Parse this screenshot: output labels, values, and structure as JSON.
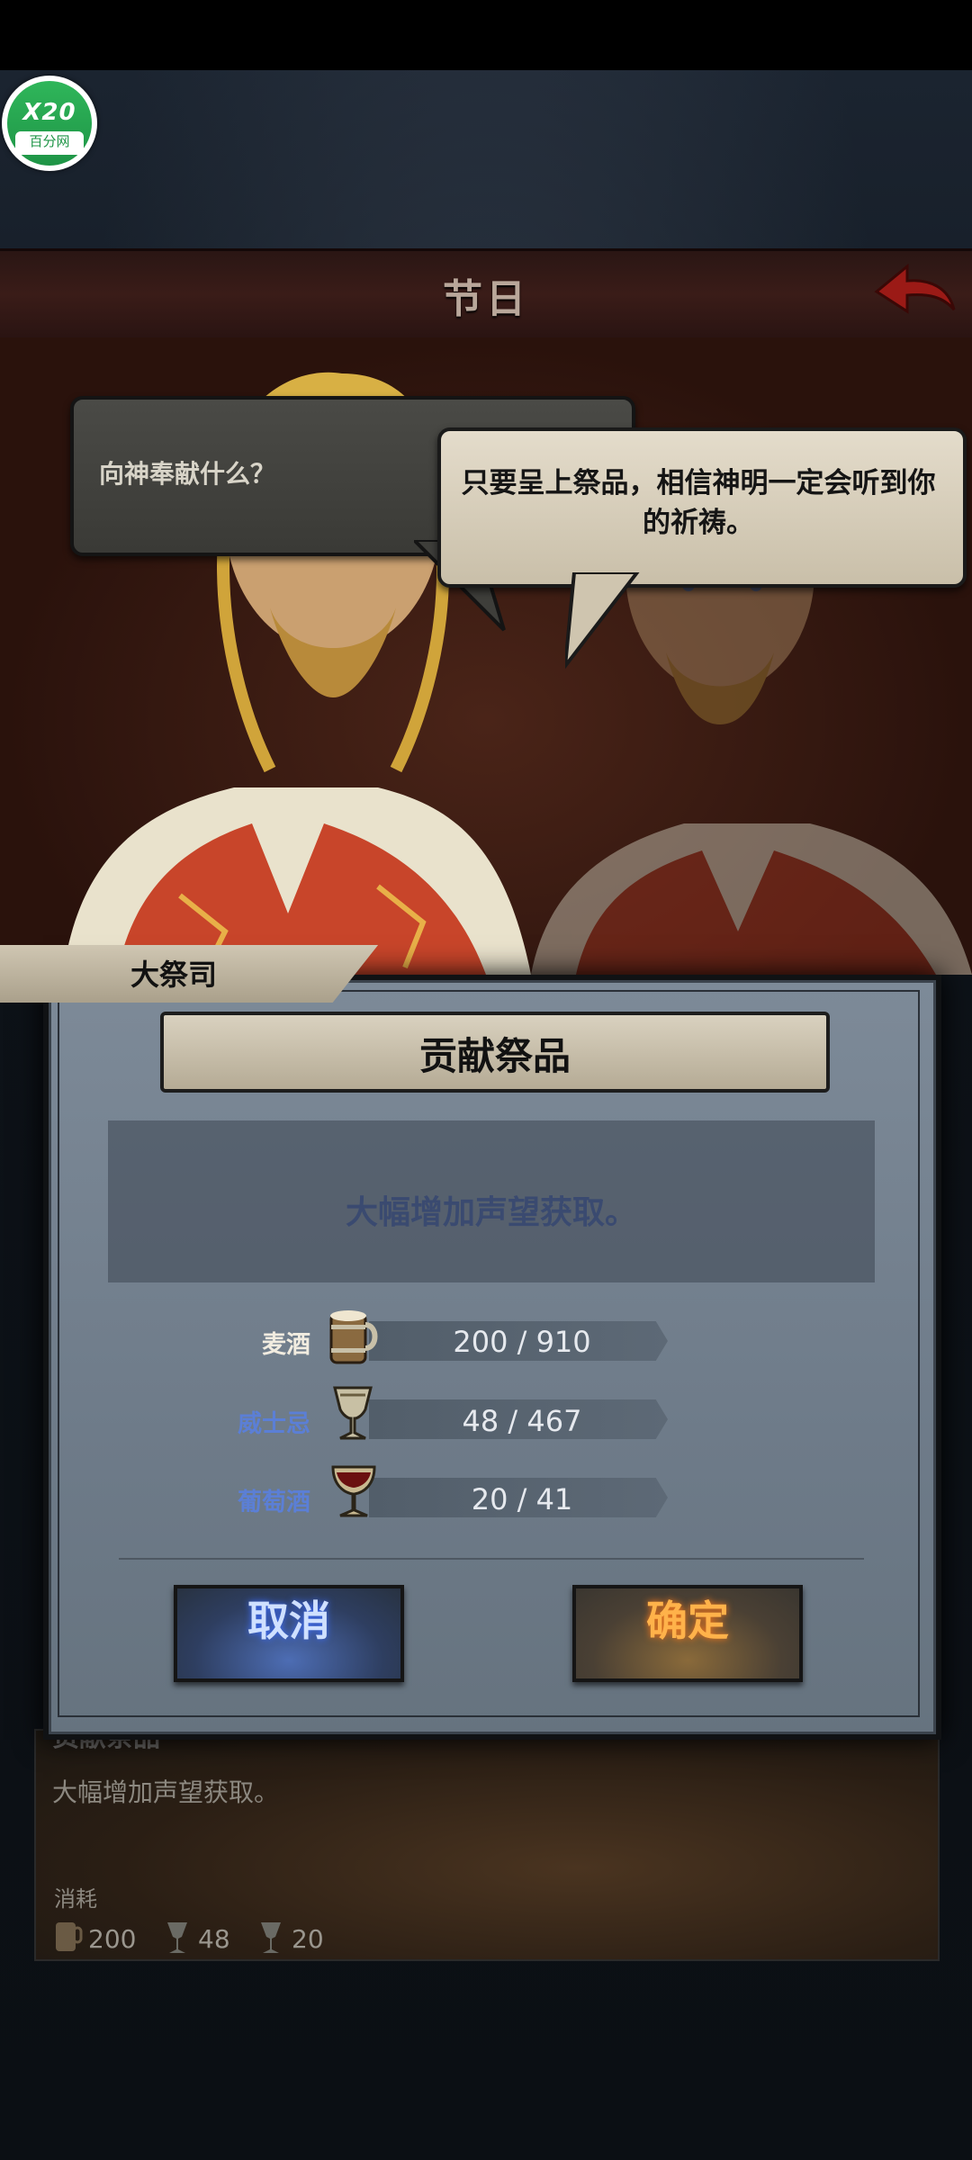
{
  "header": {
    "title": "节日"
  },
  "watermark": {
    "top": "X20",
    "bottom": "百分网"
  },
  "dialogue": {
    "player_line": "向神奉献什么？",
    "npc_line": "只要呈上祭品，相信神明一定会听到你的祈祷。",
    "speaker": "大祭司"
  },
  "dialog": {
    "title": "贡献祭品",
    "description": "大幅增加声望获取。",
    "resources": [
      {
        "label": "麦酒",
        "value": "200 / 910",
        "color": "#f1ece0",
        "icon": "ale-mug-icon"
      },
      {
        "label": "威士忌",
        "value": "48 / 467",
        "color": "#5b7fd6",
        "icon": "whisky-goblet-icon"
      },
      {
        "label": "葡萄酒",
        "value": "20 / 41",
        "color": "#5b7fd6",
        "icon": "wine-goblet-icon"
      }
    ],
    "cancel_label": "取消",
    "confirm_label": "确定"
  },
  "card": {
    "title": "贡献祭品",
    "description": "大幅增加声望获取。",
    "cost_label": "消耗",
    "costs": [
      "200",
      "48",
      "20"
    ]
  },
  "colors": {
    "accent_cancel": "#3b6cff",
    "accent_confirm": "#ff9a2a",
    "title_bar": "#3a1c18"
  }
}
